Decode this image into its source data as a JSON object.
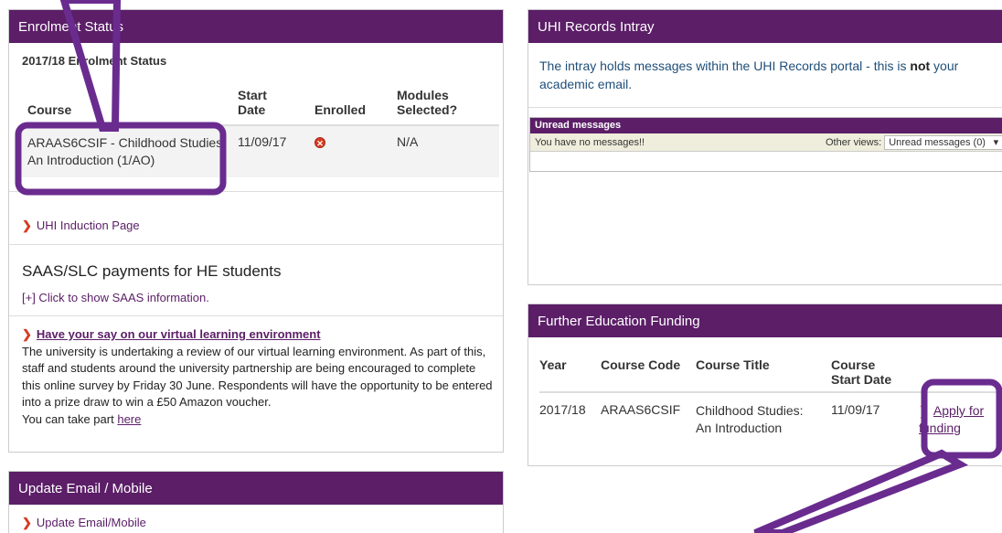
{
  "enrolment": {
    "title": "Enrolment Status",
    "subtitle": "2017/18 Enrolment Status",
    "headers": [
      "Course",
      "Start Date",
      "Enrolled",
      "Modules Selected?"
    ],
    "row": {
      "course": "ARAAS6CSIF - Childhood Studies: An Introduction (1/AO)",
      "start": "11/09/17",
      "enrolled_icon": "x-circle-icon",
      "modules": "N/A"
    },
    "induction_link": "UHI Induction Page",
    "saas_heading": "SAAS/SLC payments for HE students",
    "saas_toggle": "[+] Click to show SAAS information.",
    "survey_title": "Have your say on our virtual learning environment",
    "survey_text": "The university is undertaking a review of our virtual learning environment. As part of this, staff and students around the university partnership are being encouraged to complete this online survey by Friday 30 June. Respondents will have the opportunity to be entered into a prize draw to win a £50 Amazon voucher.",
    "survey_cta_prefix": "You can take part",
    "survey_cta_link": "here"
  },
  "update": {
    "title": "Update Email / Mobile",
    "link": "Update Email/Mobile"
  },
  "intray": {
    "title": "UHI Records Intray",
    "info_pre": "The intray holds messages within the UHI Records portal - this is",
    "info_bold": "not",
    "info_post": "your academic email.",
    "unread_header": "Unread messages",
    "empty": "You have no messages!!",
    "other_views_label": "Other views:",
    "other_views_value": "Unread messages (0)"
  },
  "funding": {
    "title": "Further Education Funding",
    "headers": [
      "Year",
      "Course Code",
      "Course Title",
      "Course Start Date"
    ],
    "row": {
      "year": "2017/18",
      "code": "ARAAS6CSIF",
      "title": "Childhood Studies: An Introduction",
      "start": "11/09/17"
    },
    "apply_link": "Apply for funding"
  },
  "colors": {
    "brand": "#5b1e67",
    "chevron": "#d63c23"
  }
}
